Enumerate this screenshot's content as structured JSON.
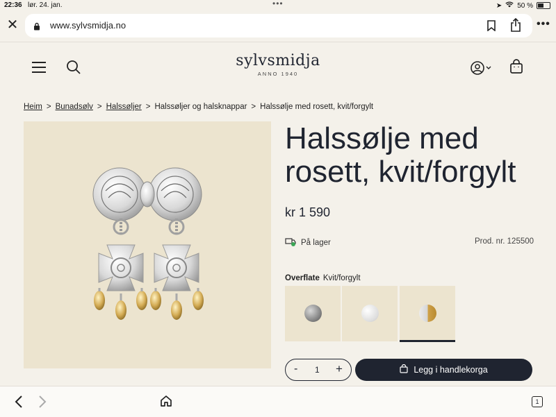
{
  "status_bar": {
    "time": "22:36",
    "date": "lør. 24. jan.",
    "battery": "50 %"
  },
  "browser": {
    "url": "www.sylvsmidja.no",
    "tab_count": "1"
  },
  "site": {
    "logo_name": "sylvsmidja",
    "logo_sub": "ANNO 1940"
  },
  "breadcrumb": {
    "items": [
      "Heim",
      "Bunadsølv",
      "Halssøljer",
      "Halssøljer og halsknappar",
      "Halssølje med rosett, kvit/forgylt"
    ],
    "separator": ">"
  },
  "product": {
    "title": "Halssølje med rosett, kvit/forgylt",
    "price": "kr 1 590",
    "stock": "På lager",
    "product_number": "Prod. nr. 125500",
    "finish_label": "Overflate",
    "finish_value": "Kvit/forgylt",
    "swatches": [
      "oksidert",
      "kvit",
      "kvit/forgylt"
    ],
    "selected_swatch_index": 2,
    "quantity": "1",
    "minus": "-",
    "plus": "+",
    "add_to_cart": "Legg i handlekorga"
  },
  "colors": {
    "accent": "#1f2430",
    "page_bg": "#f4f1ea",
    "image_bg": "#ece4cf",
    "stock_green": "#3aa655"
  }
}
